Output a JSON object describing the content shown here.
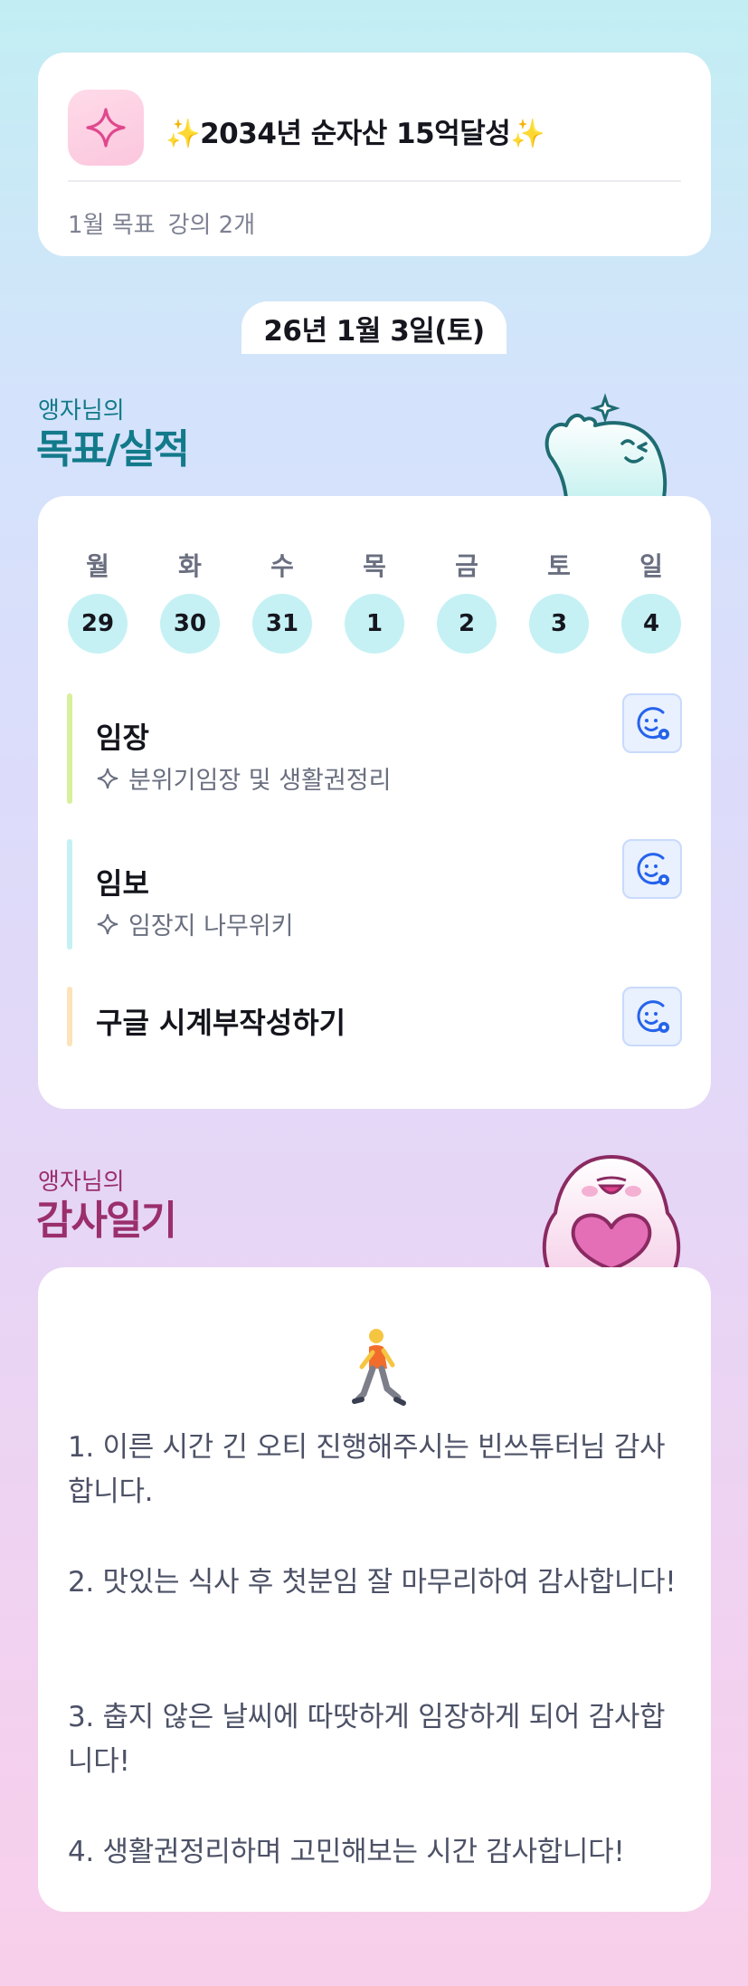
{
  "goal": {
    "title": "2034년 순자산 15억달성",
    "spark_left": "✨",
    "spark_right": "✨",
    "month_goal_label": "1월 목표",
    "month_goal_value": "강의 2개",
    "icon": "sparkle-icon"
  },
  "date": "26년 1월 3일(토)",
  "goals_section": {
    "subtitle": "앵자님의",
    "title": "목표/실적"
  },
  "calendar": {
    "weekdays": [
      "월",
      "화",
      "수",
      "목",
      "금",
      "토",
      "일"
    ],
    "days": [
      "29",
      "30",
      "31",
      "1",
      "2",
      "3",
      "4"
    ]
  },
  "tasks": [
    {
      "title": "임장",
      "detail": "분위기임장 및 생활권정리",
      "bar_color": "#d8ef9c",
      "icon": "smiley-icon"
    },
    {
      "title": "임보",
      "detail": "임장지 나무위키",
      "bar_color": "#c5f1f4",
      "icon": "smiley-icon"
    },
    {
      "title": "구글 시계부작성하기",
      "detail": "",
      "bar_color": "#fde3b9",
      "icon": "smiley-icon"
    }
  ],
  "diary_section": {
    "subtitle": "앵자님의",
    "title": "감사일기"
  },
  "diary": {
    "emoji_icon": "person-walking-icon",
    "lines": [
      "1. 이른 시간 긴 오티 진행해주시는 빈쓰튜터님 감사합니다.",
      "2. 맛있는 식사 후 첫분임 잘 마무리하여 감사합니다!",
      "3. 춥지 않은 날씨에 따땃하게 임장하게 되어 감사합니다!",
      "4. 생활권정리하며 고민해보는 시간 감사합니다!"
    ]
  },
  "colors": {
    "teal_accent": "#127a8a",
    "pink_accent": "#9a2f6c",
    "day_circle": "#c5f1f4",
    "button_blue": "#2563eb"
  }
}
